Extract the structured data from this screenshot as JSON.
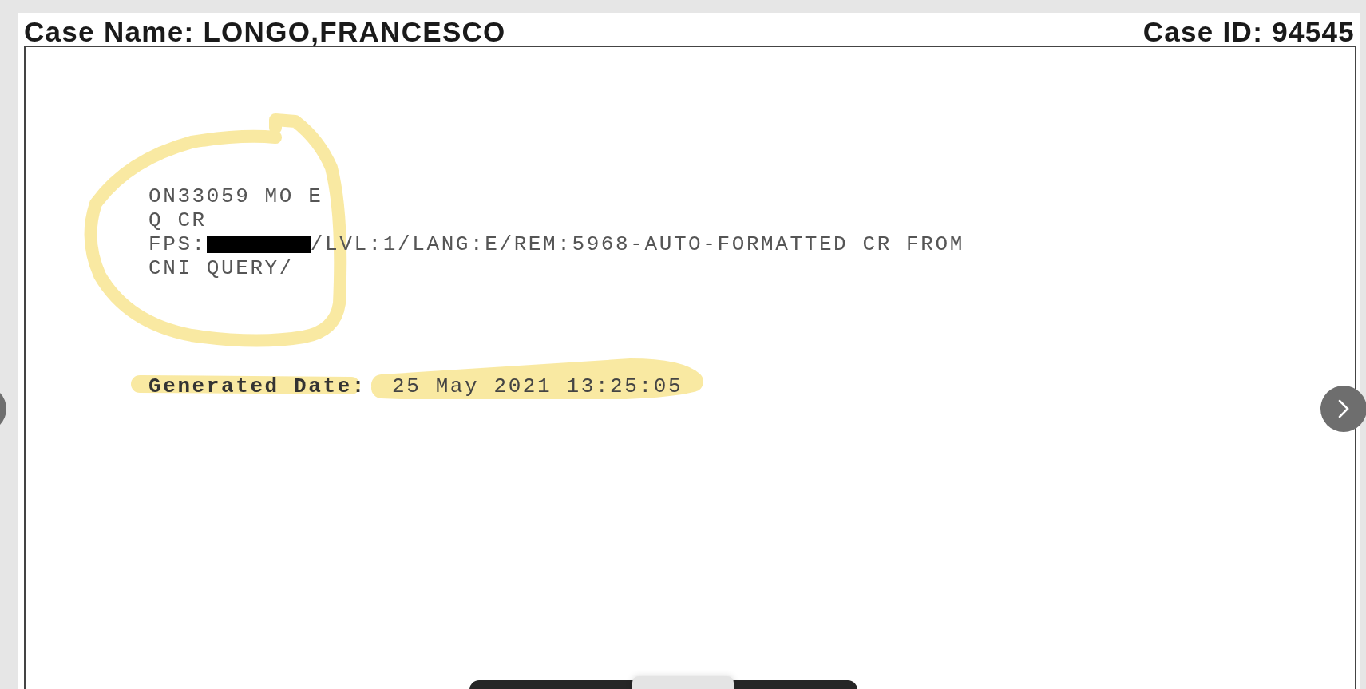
{
  "header": {
    "case_name": "Case Name: LONGO,FRANCESCO",
    "case_id": "Case ID: 94545"
  },
  "document": {
    "lines": [
      [
        {
          "kind": "text",
          "text": "ON33059 MO E"
        }
      ],
      [
        {
          "kind": "text",
          "text": "Q CR"
        }
      ],
      [
        {
          "kind": "text",
          "text": "FPS:"
        },
        {
          "kind": "redaction"
        },
        {
          "kind": "text",
          "text": "/LVL:1/LANG:E/REM:5968-AUTO-FORMATTED CR FROM"
        }
      ],
      [
        {
          "kind": "text",
          "text": "CNI QUERY/"
        }
      ]
    ],
    "generated_label": "Generated Date:",
    "generated_value": "25 May 2021 13:25:05"
  }
}
